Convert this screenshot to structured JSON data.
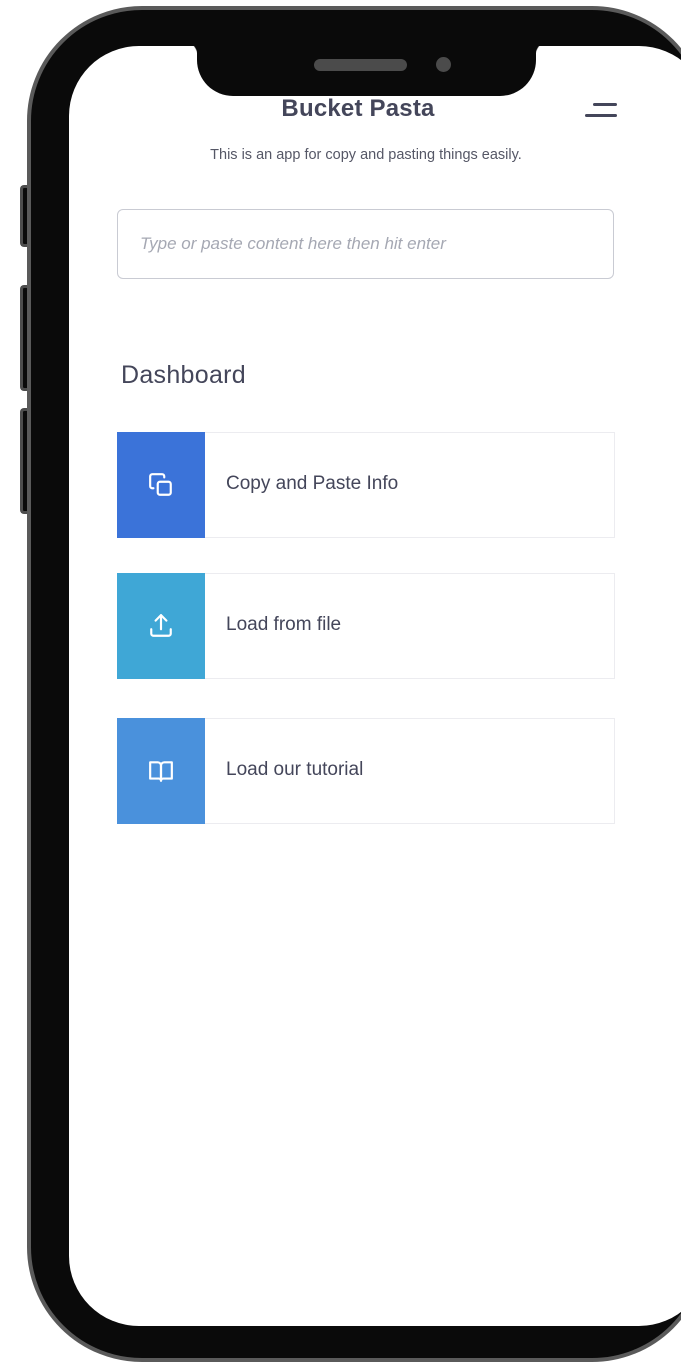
{
  "app": {
    "title": "Bucket Pasta",
    "subtitle": "This is an app for copy and pasting things easily."
  },
  "search": {
    "placeholder": "Type or paste content here then hit enter",
    "value": ""
  },
  "dashboard": {
    "title": "Dashboard",
    "items": [
      {
        "label": "Copy and Paste Info",
        "icon": "copy-icon",
        "color": "#3b73d9"
      },
      {
        "label": "Load from file",
        "icon": "upload-icon",
        "color": "#3fa7d6"
      },
      {
        "label": "Load our tutorial",
        "icon": "book-icon",
        "color": "#4a91dc"
      }
    ]
  },
  "colors": {
    "text_primary": "#44465a",
    "text_secondary": "#555766",
    "placeholder": "#a5a8b3",
    "phone_frame": "#0a0a0a"
  },
  "menu": {
    "icon": "hamburger-menu-icon"
  }
}
